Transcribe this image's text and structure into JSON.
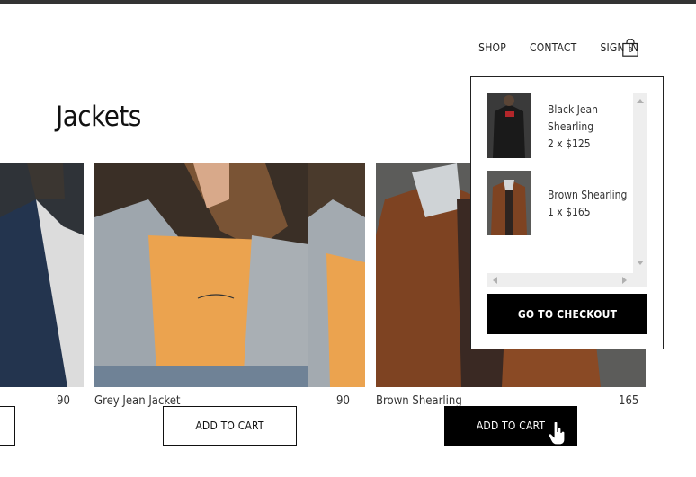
{
  "nav": {
    "shop": "SHOP",
    "contact": "CONTACT",
    "sign_in": "SIGN IN",
    "cart_count": "3"
  },
  "page": {
    "title": "Jackets"
  },
  "products": [
    {
      "name": "",
      "price": "90",
      "button": ""
    },
    {
      "name": "Grey Jean Jacket",
      "price": "90",
      "button": "ADD TO CART"
    },
    {
      "name": "Brown Shearling",
      "price": "165",
      "button": "ADD TO CART"
    }
  ],
  "cart": {
    "items": [
      {
        "name_line1": "Black Jean",
        "name_line2": "Shearling",
        "qty_price": "2 x $125"
      },
      {
        "name_line1": "Brown Shearling",
        "qty_price": "1 x $165"
      }
    ],
    "checkout_label": "GO TO CHECKOUT"
  },
  "colors": {
    "background": "#ffffff",
    "text": "#222222",
    "button_dark": "#000000",
    "accent_orange": "#e8a04a"
  },
  "icons": {
    "cart": "shopping-bag-icon",
    "cursor": "hand-pointer-icon"
  }
}
